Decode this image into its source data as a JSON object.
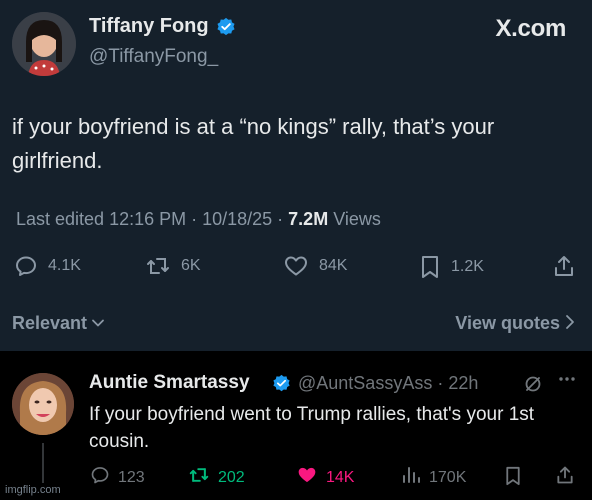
{
  "brand": "X.com",
  "post": {
    "author_name": "Tiffany Fong",
    "author_handle": "@TiffanyFong_",
    "text": "if your boyfriend is at a “no kings” rally, that’s your girlfriend.",
    "meta": {
      "edited_prefix": "Last edited 12:16 PM · 10/18/25  · ",
      "views_count": "7.2M",
      "views_label": " Views"
    },
    "actions": {
      "replies": "4.1K",
      "reposts": "6K",
      "likes": "84K",
      "bookmarks": "1.2K"
    },
    "relevant_label": "Relevant",
    "view_quotes_label": "View quotes"
  },
  "reply": {
    "author_name": "Auntie Smartassy",
    "author_handle_time": "@AuntSassyAss · 22h",
    "text": "If your boyfriend went to Trump rallies,  that's your 1st cousin.",
    "actions": {
      "replies": "123",
      "reposts": "202",
      "likes": "14K",
      "views": "170K"
    }
  },
  "watermark": "imgflip.com",
  "colors": {
    "background_post": "#15202b",
    "background_reply": "#000000",
    "verified": "#1d9bf0",
    "repost_active": "#00ba7c",
    "like_active": "#f91880",
    "text_primary": "#e7e9ea",
    "text_secondary": "#8b98a5"
  },
  "icons": [
    "verified-badge-icon",
    "reply-icon",
    "repost-icon",
    "like-icon",
    "bookmark-icon",
    "share-icon",
    "views-icon",
    "chevron-down-icon",
    "chevron-right-icon",
    "grok-icon",
    "more-icon"
  ]
}
